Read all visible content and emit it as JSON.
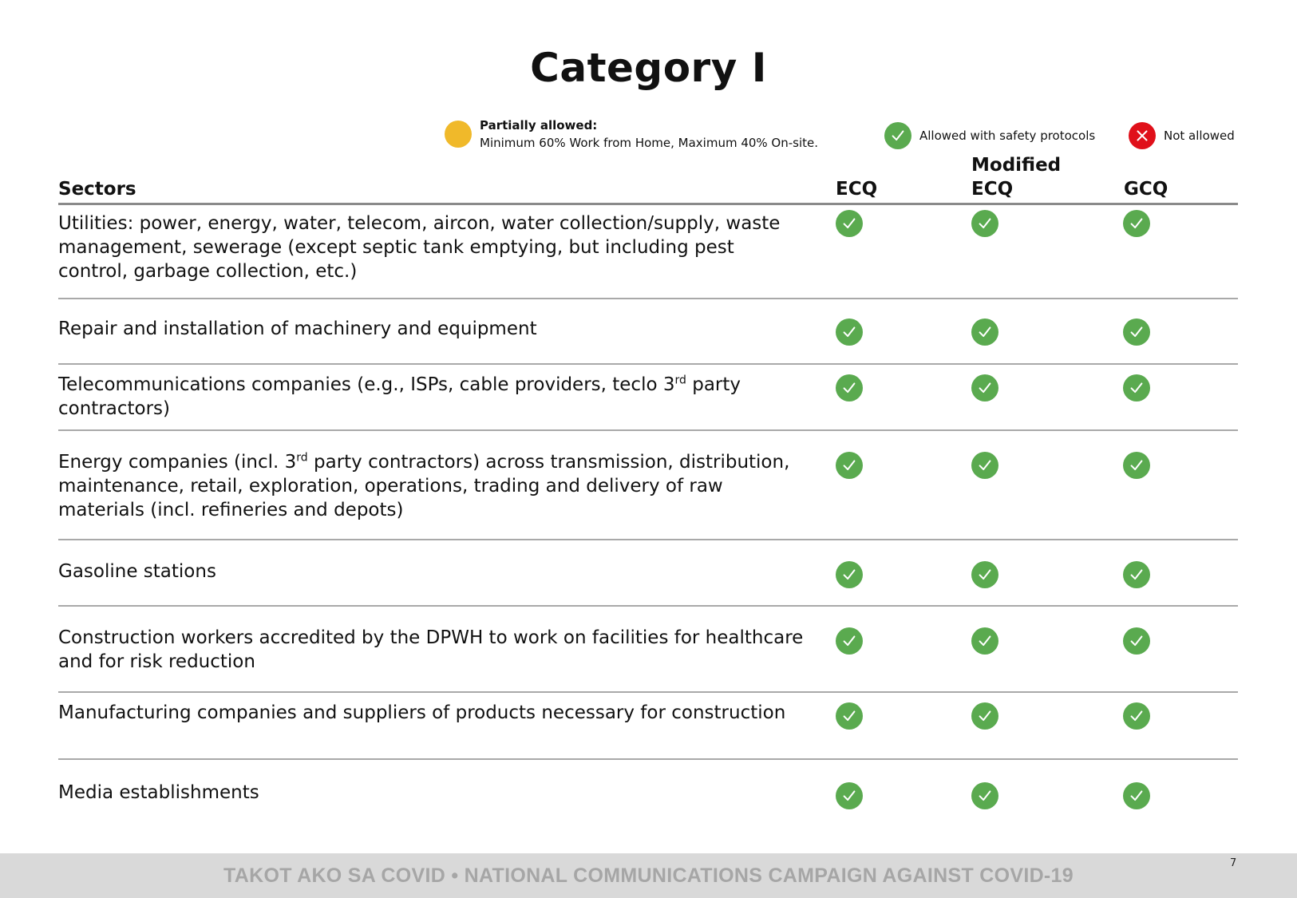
{
  "page": {
    "title": "Category I",
    "page_number": "7"
  },
  "legend": {
    "partial": {
      "title": "Partially allowed:",
      "description": "Minimum 60% Work from Home,  Maximum 40% On-site.",
      "color": "#f0b92a",
      "icon": "yellow-circle-icon"
    },
    "allowed": {
      "label": "Allowed with safety protocols",
      "color": "#5aaa4f",
      "icon": "check-circle-icon"
    },
    "not_allowed": {
      "label": "Not allowed",
      "color": "#e0101a",
      "icon": "x-circle-icon"
    }
  },
  "table": {
    "headers": {
      "sectors": "Sectors",
      "ecq": "ECQ",
      "mecq_line1": "Modified",
      "mecq_line2": "ECQ",
      "gcq": "GCQ"
    },
    "rows": [
      {
        "sector_parts": [
          "Utilities: power, energy, water, telecom, aircon, water collection/supply, waste management, sewerage (except septic tank emptying, but including pest control, garbage collection, etc.)"
        ],
        "ecq": "allowed",
        "mecq": "allowed",
        "gcq": "allowed"
      },
      {
        "sector_parts": [
          "Repair and installation of machinery and equipment"
        ],
        "ecq": "allowed",
        "mecq": "allowed",
        "gcq": "allowed"
      },
      {
        "sector_parts": [
          "Telecommunications companies (e.g., ISPs, cable providers, teclo 3",
          "rd",
          " party contractors)"
        ],
        "ecq": "allowed",
        "mecq": "allowed",
        "gcq": "allowed"
      },
      {
        "sector_parts": [
          "Energy companies (incl. 3",
          "rd",
          " party contractors) across transmission, distribution, maintenance, retail, exploration, operations, trading and delivery of raw materials (incl. refineries and depots)"
        ],
        "ecq": "allowed",
        "mecq": "allowed",
        "gcq": "allowed"
      },
      {
        "sector_parts": [
          "Gasoline stations"
        ],
        "ecq": "allowed",
        "mecq": "allowed",
        "gcq": "allowed"
      },
      {
        "sector_parts": [
          "Construction workers accredited by the DPWH to work on facilities for healthcare and for risk reduction"
        ],
        "ecq": "allowed",
        "mecq": "allowed",
        "gcq": "allowed"
      },
      {
        "sector_parts": [
          "Manufacturing companies and suppliers of products necessary for construction"
        ],
        "ecq": "allowed",
        "mecq": "allowed",
        "gcq": "allowed"
      },
      {
        "sector_parts": [
          "Media establishments"
        ],
        "ecq": "allowed",
        "mecq": "allowed",
        "gcq": "allowed"
      }
    ]
  },
  "footer": {
    "text": "TAKOT AKO SA COVID • NATIONAL COMMUNICATIONS CAMPAIGN AGAINST COVID-19"
  }
}
